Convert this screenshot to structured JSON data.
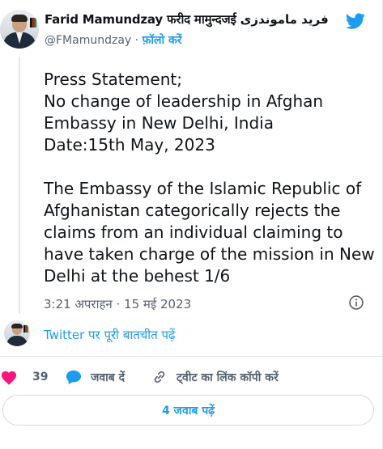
{
  "author": {
    "display_name": "Farid Mamundzay फरीद मामुन्दजई فرید ماموندزی",
    "handle": "@FMamundzay",
    "separator": "·",
    "follow_label": "फ़ॉलो करें"
  },
  "tweet": {
    "text": "Press Statement;\nNo change of leadership in Afghan Embassy in New Delhi, India\nDate:15th May, 2023\n\nThe Embassy of the Islamic Republic of Afghanistan categorically rejects the claims from an individual claiming to have taken charge of the mission in New Delhi at the behest 1/6",
    "timestamp": "3:21 अपराहन · 15 मई 2023"
  },
  "conversation_link": "Twitter पर पूरी बातचीत पढ़ें",
  "actions": {
    "like_count": "39",
    "reply_label": "जवाब दें",
    "copy_link_label": "ट्वीट का लिंक कॉपी करें"
  },
  "replies_button_label": "4 जवाब पढ़ें",
  "colors": {
    "accent": "#1d9bf0",
    "like": "#f91880",
    "muted": "#536471"
  },
  "icons": [
    "twitter-bird-icon",
    "info-icon",
    "heart-icon",
    "reply-bubble-icon",
    "link-icon"
  ]
}
